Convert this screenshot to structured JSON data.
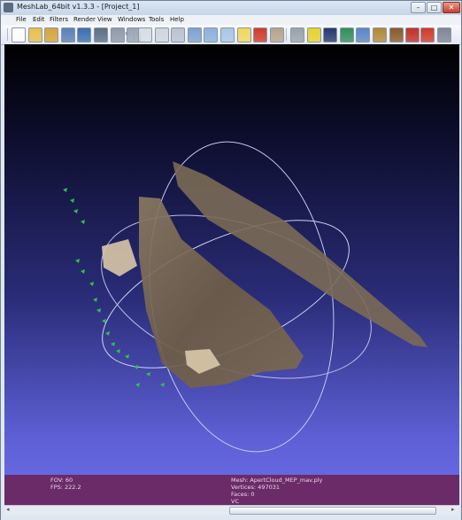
{
  "window": {
    "title": "MeshLab_64bit v1.3.3 - [Project_1]",
    "minimize": "–",
    "maximize": "□",
    "close": "✕"
  },
  "menu": [
    "File",
    "Edit",
    "Filters",
    "Render",
    "View",
    "Windows",
    "Tools",
    "Help"
  ],
  "toolbar": {
    "group1": [
      {
        "icon": "new-project-icon",
        "color": "#ffffff"
      },
      {
        "icon": "open-project-icon",
        "color": "#e8c04a"
      },
      {
        "icon": "open-mesh-icon",
        "color": "#d4a53a"
      },
      {
        "icon": "reload-icon",
        "color": "#5b7fb5"
      },
      {
        "icon": "save-icon",
        "color": "#3b6fb0"
      },
      {
        "icon": "snapshot-icon",
        "color": "#5c6f86"
      },
      {
        "icon": "layer-dialog-icon",
        "color": "#8e9aaa"
      },
      {
        "icon": "bounding-box-icon",
        "color": "#9aa5b4"
      }
    ],
    "group2": [
      {
        "icon": "points-icon",
        "color": "#d8dde5"
      },
      {
        "icon": "wireframe-icon",
        "color": "#cfd6df"
      },
      {
        "icon": "hidden-lines-icon",
        "color": "#b9c3d0"
      },
      {
        "icon": "flat-lines-icon",
        "color": "#7ea2cf"
      },
      {
        "icon": "flat-icon",
        "color": "#8cb0dc"
      },
      {
        "icon": "smooth-icon",
        "color": "#aac6e6"
      },
      {
        "icon": "light-icon",
        "color": "#f0d85a"
      },
      {
        "icon": "color-icon",
        "color": "#cf3b2c"
      },
      {
        "icon": "texture-icon",
        "color": "#b6a48c"
      }
    ],
    "group3": [
      {
        "icon": "select-faces-icon",
        "color": "#9aa3ad"
      },
      {
        "icon": "measure-icon",
        "color": "#e7d22a"
      },
      {
        "icon": "shader-icon",
        "color": "#273a6e"
      },
      {
        "icon": "align-icon",
        "color": "#2f8f5a"
      },
      {
        "icon": "pickpoints-icon",
        "color": "#5a86c6"
      },
      {
        "icon": "paint-icon",
        "color": "#b08a36"
      },
      {
        "icon": "brush-icon",
        "color": "#8a5a2a"
      },
      {
        "icon": "manipulator-icon",
        "color": "#c2312a"
      }
    ],
    "group4": [
      {
        "icon": "delete-icon",
        "color": "#d23a2a"
      },
      {
        "icon": "zoom-icon",
        "color": "#7d8796"
      }
    ],
    "more1": "»",
    "more2": "»"
  },
  "viewport": {
    "info_left": {
      "fov": "FOV: 60",
      "fps": "FPS:   222.2"
    },
    "info_right": {
      "mesh": "Mesh: ApertCloud_MEP_mav.ply",
      "vertices": "Vertices: 497031",
      "faces": "Faces: 0",
      "vc": "VC"
    }
  },
  "scrollbar": {
    "left_arrow": "◂",
    "right_arrow": "▸"
  }
}
